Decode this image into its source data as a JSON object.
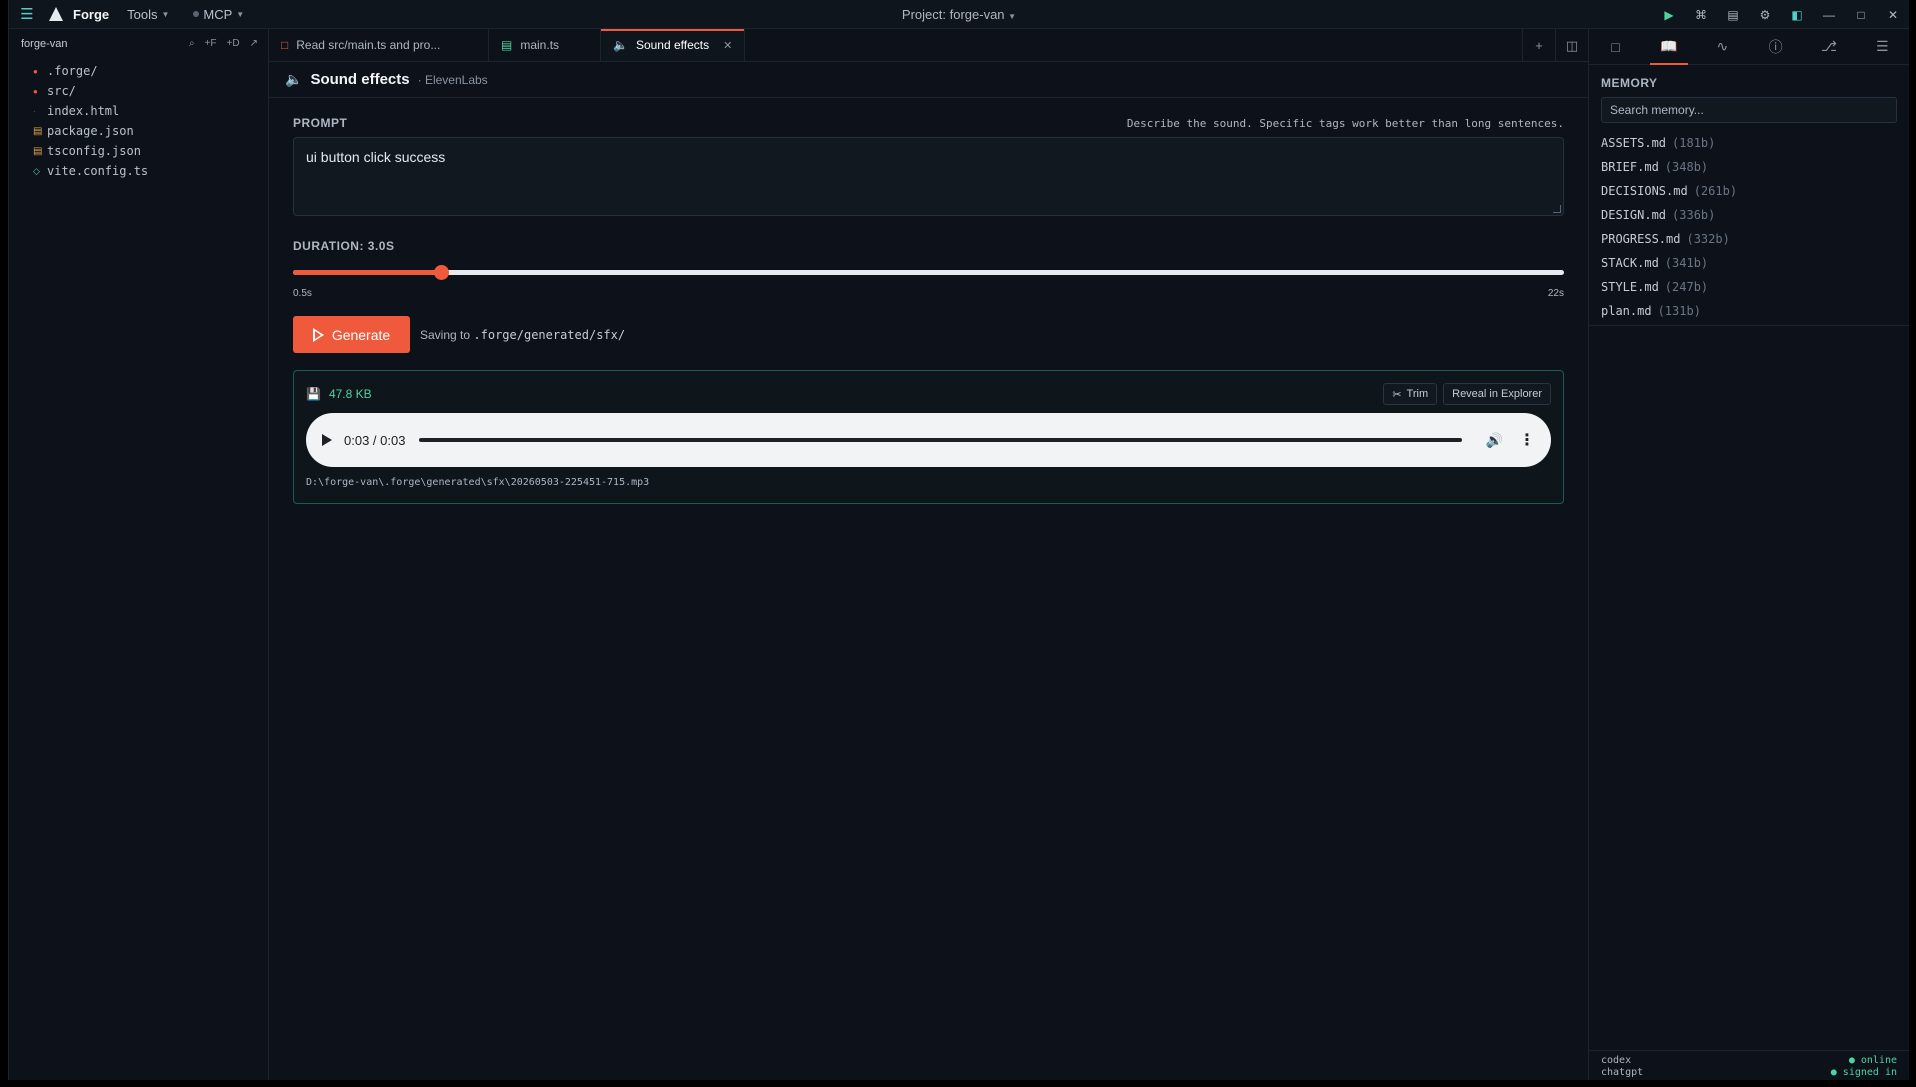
{
  "titlebar": {
    "app_name": "Forge",
    "menus": [
      "Tools",
      "MCP"
    ],
    "project": "Project: forge-van"
  },
  "sidebar": {
    "title": "forge-van",
    "actions": [
      "⌕",
      "+F",
      "+D",
      "↗"
    ],
    "files": [
      {
        "name": ".forge/",
        "kind": "folder"
      },
      {
        "name": "src/",
        "kind": "folder"
      },
      {
        "name": "index.html",
        "kind": "html"
      },
      {
        "name": "package.json",
        "kind": "json"
      },
      {
        "name": "tsconfig.json",
        "kind": "json"
      },
      {
        "name": "vite.config.ts",
        "kind": "ts"
      }
    ]
  },
  "tabs": [
    {
      "label": "Read src/main.ts and pro...",
      "icon": "chat-icon"
    },
    {
      "label": "main.ts",
      "icon": "file-icon"
    },
    {
      "label": "Sound effects",
      "icon": "speaker-icon",
      "active": true
    }
  ],
  "panel": {
    "title": "Sound effects",
    "provider": "· ElevenLabs",
    "prompt_label": "PROMPT",
    "prompt_hint": "Describe the sound. Specific tags work better than long sentences.",
    "prompt_value": "ui button click success",
    "duration_label": "DURATION: 3.0S",
    "duration_value": 3.0,
    "duration_min": 0.5,
    "duration_max": 22,
    "min_label": "0.5s",
    "max_label": "22s",
    "generate_label": "Generate",
    "saving_prefix": "Saving to",
    "saving_path": ".forge/generated/sfx/",
    "result": {
      "size": "47.8 KB",
      "trim_label": "Trim",
      "reveal_label": "Reveal in Explorer",
      "time": "0:03 / 0:03",
      "progress": 1.0,
      "path": "D:\\forge-van\\.forge\\generated\\sfx\\20260503-225451-715.mp3"
    }
  },
  "memory": {
    "title": "MEMORY",
    "search_placeholder": "Search memory...",
    "items": [
      {
        "name": "ASSETS.md",
        "size": "(181b)"
      },
      {
        "name": "BRIEF.md",
        "size": "(348b)"
      },
      {
        "name": "DECISIONS.md",
        "size": "(261b)"
      },
      {
        "name": "DESIGN.md",
        "size": "(336b)"
      },
      {
        "name": "PROGRESS.md",
        "size": "(332b)"
      },
      {
        "name": "STACK.md",
        "size": "(341b)"
      },
      {
        "name": "STYLE.md",
        "size": "(247b)"
      },
      {
        "name": "plan.md",
        "size": "(131b)"
      }
    ]
  },
  "status": [
    {
      "name": "codex",
      "state": "● online"
    },
    {
      "name": "chatgpt",
      "state": "● signed in"
    }
  ],
  "colors": {
    "accent": "#ef5a3c",
    "teal": "#4fd1a1",
    "background": "#0d121a"
  }
}
